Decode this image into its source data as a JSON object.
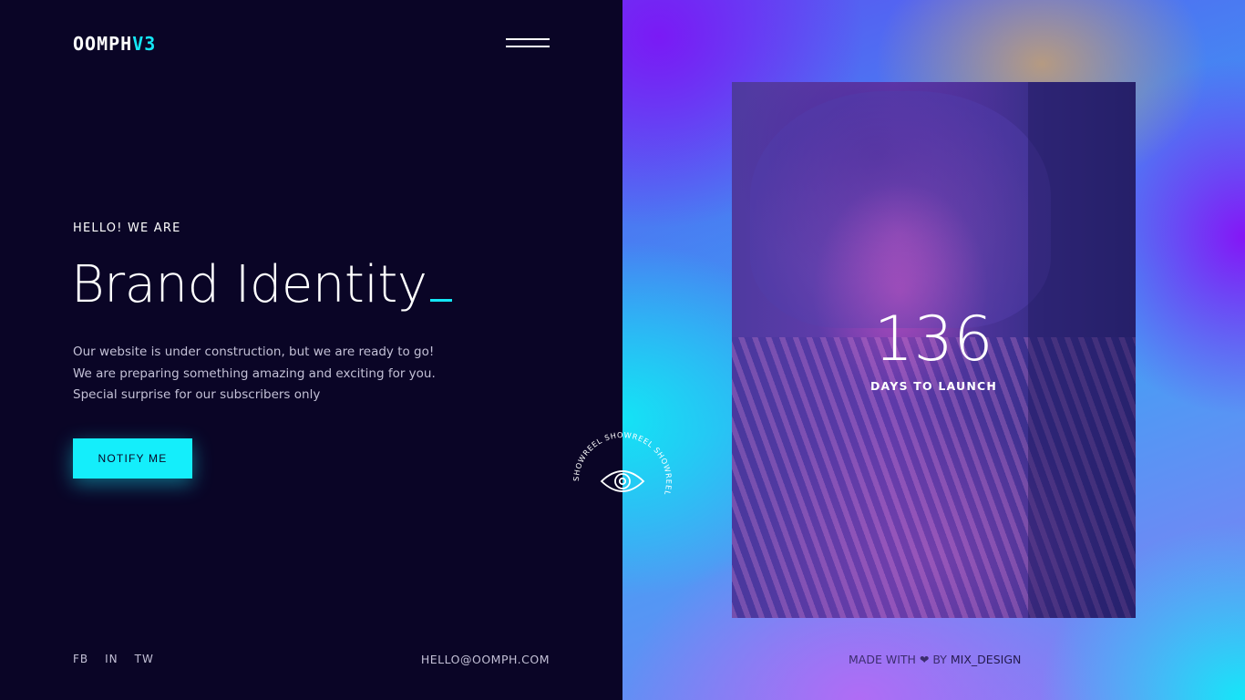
{
  "brand": {
    "logo_main": "OOMPH",
    "logo_accent": "V3",
    "accent_color": "#14e6f5"
  },
  "header": {
    "menu_icon": "hamburger-icon"
  },
  "hero": {
    "eyebrow": "HELLO! WE ARE",
    "title": "Brand Identity",
    "description_lines": [
      "Our website is under construction, but we are ready to go!",
      "We are preparing something amazing and exciting for you.",
      "Special surprise for our subscribers only"
    ],
    "cta_label": "NOTIFY ME"
  },
  "footer": {
    "socials": [
      "FB",
      "IN",
      "TW"
    ],
    "email": "HELLO@OOMPH.COM"
  },
  "countdown": {
    "value": "136",
    "label": "DAYS TO LAUNCH"
  },
  "showreel": {
    "text": "SHOWREEL SHOWREEL SHOWREEL ",
    "icon": "eye-icon"
  },
  "credit": {
    "prefix": "MADE WITH",
    "heart_icon": "heart-icon",
    "by": "BY",
    "author": "MIX_DESIGN"
  }
}
